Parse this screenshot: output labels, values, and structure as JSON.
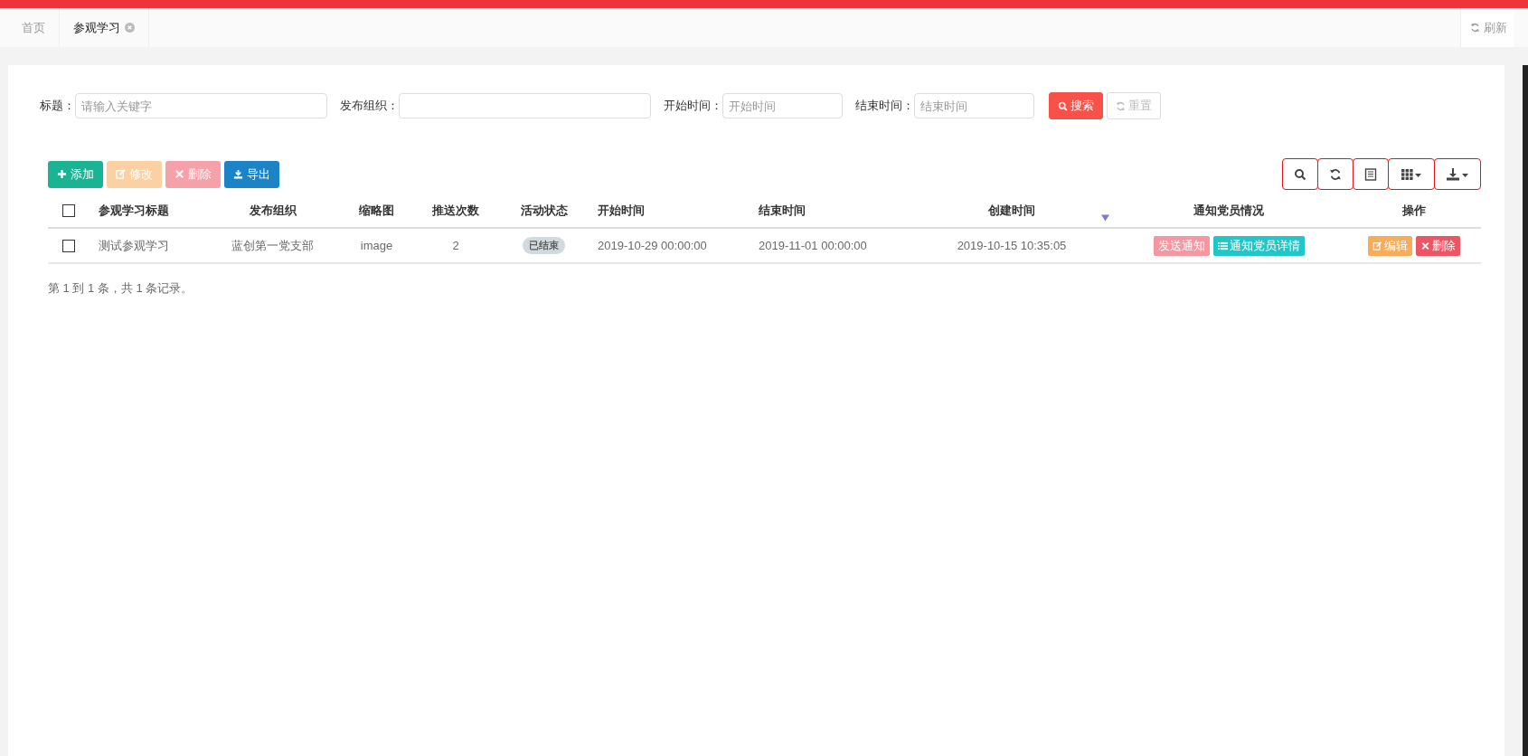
{
  "tabs": [
    {
      "label": "首页",
      "selected": false,
      "closable": false
    },
    {
      "label": "参观学习",
      "selected": true,
      "closable": true
    }
  ],
  "refresh": {
    "label": "刷新"
  },
  "filters": [
    {
      "label": "标题：",
      "placeholder": "请输入关键字"
    },
    {
      "label": "发布组织："
    },
    {
      "label": "开始时间：",
      "placeholder": "开始时间"
    },
    {
      "label": "结束时间：",
      "placeholder": "结束时间"
    }
  ],
  "search_button": {
    "label": "搜索"
  },
  "reset_button": {
    "label": "重置",
    "disabled": true
  },
  "actions": [
    {
      "label": "添加",
      "kind": "add",
      "disabled": false
    },
    {
      "label": "修改",
      "kind": "edit",
      "disabled": true
    },
    {
      "label": "删除",
      "kind": "delete",
      "disabled": true
    },
    {
      "label": "导出",
      "kind": "export",
      "disabled": false
    }
  ],
  "table": {
    "all_checked": false,
    "columns": [
      {
        "label": "参观学习标题",
        "sorted": false
      },
      {
        "label": "发布组织",
        "sorted": false
      },
      {
        "label": "缩略图",
        "sorted": false
      },
      {
        "label": "推送次数",
        "sorted": false
      },
      {
        "label": "活动状态",
        "sorted": false
      },
      {
        "label": "开始时间",
        "sorted": false
      },
      {
        "label": "结束时间",
        "sorted": false
      },
      {
        "label": "创建时间",
        "sorted": true
      },
      {
        "label": "通知党员情况",
        "sorted": false
      },
      {
        "label": "操作",
        "sorted": false
      }
    ],
    "rows": [
      {
        "checked": false,
        "title": "测试参观学习",
        "org": "蓝创第一党支部",
        "thumbnail": "image",
        "push_count": "2",
        "status": "已结束",
        "start": "2019-10-29 00:00:00",
        "end": "2019-11-01 00:00:00",
        "created": "2019-10-15 10:35:05",
        "notify_buttons": [
          {
            "label": "发送通知",
            "kind": "send"
          },
          {
            "label": "通知党员详情",
            "kind": "detail"
          }
        ],
        "row_actions": [
          {
            "label": "编辑",
            "kind": "edit"
          },
          {
            "label": "删除",
            "kind": "delete"
          }
        ]
      }
    ]
  },
  "pagination": "第 1 到 1 条，共 1 条记录。"
}
